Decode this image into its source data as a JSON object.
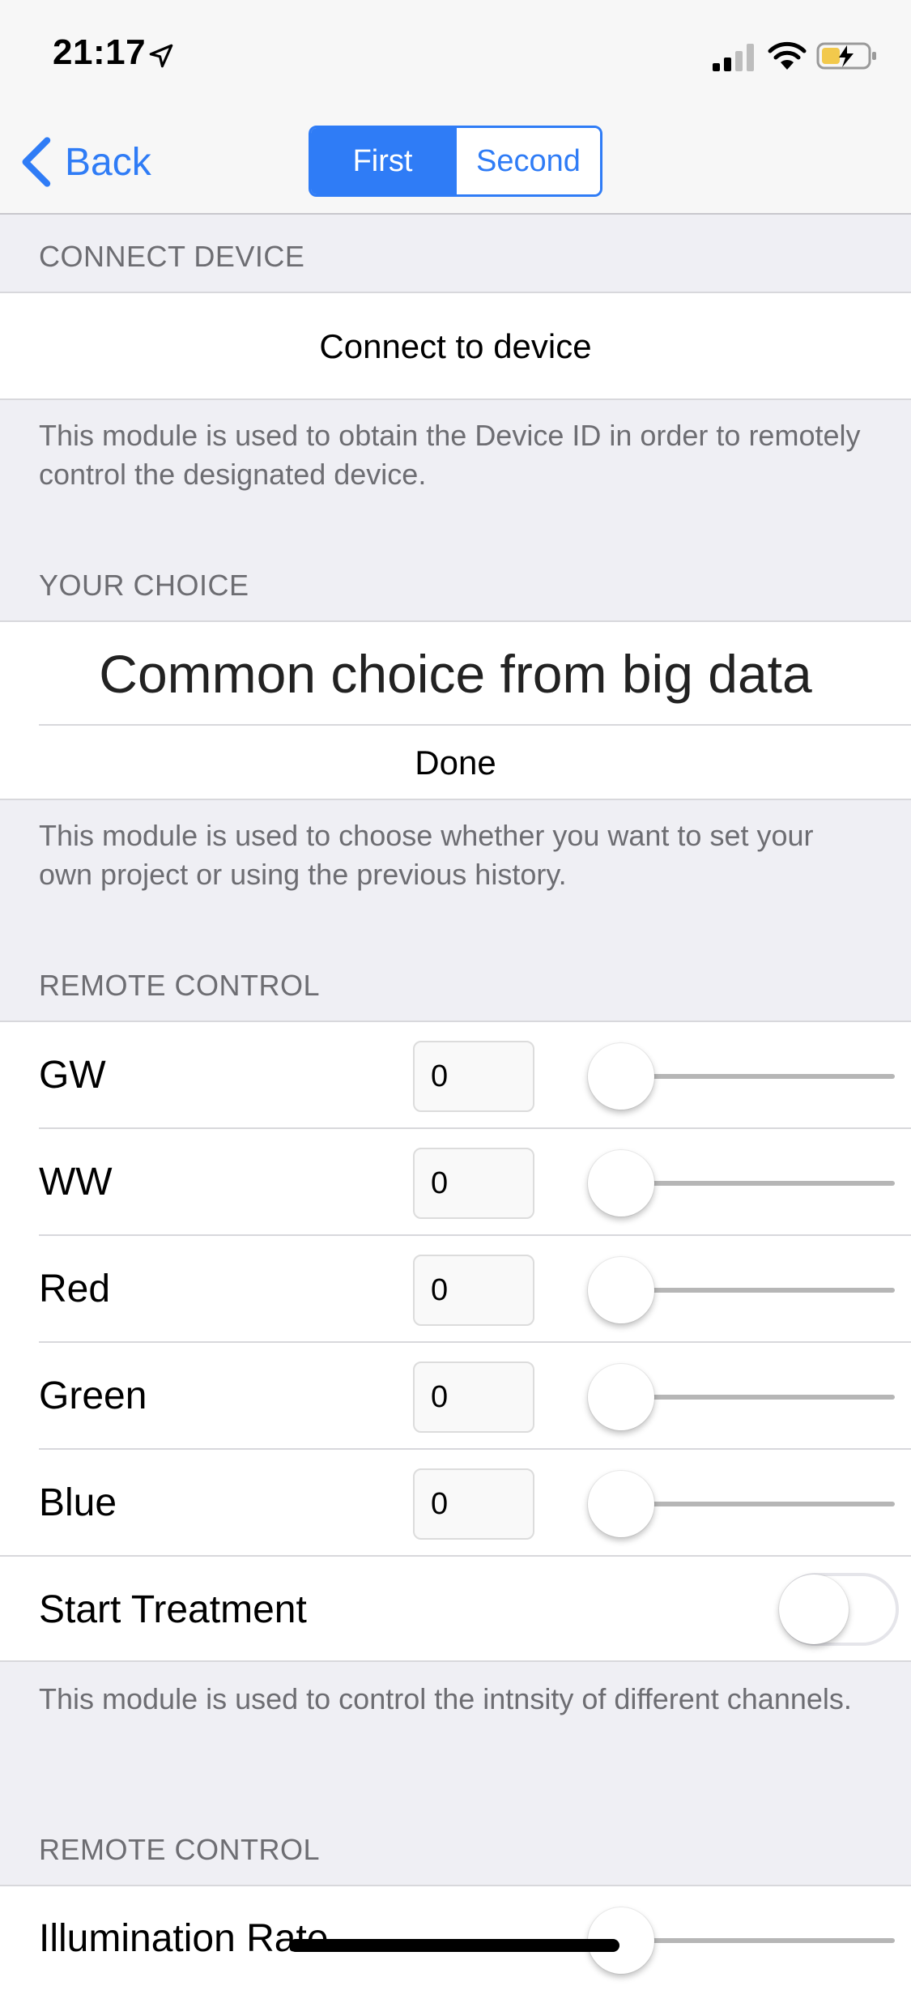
{
  "status_bar": {
    "time": "21:17",
    "icons": [
      "location-arrow-icon",
      "cellular-signal-icon",
      "wifi-icon",
      "battery-charging-icon"
    ]
  },
  "nav": {
    "back_label": "Back",
    "segments": [
      "First",
      "Second"
    ],
    "selected_segment": "First"
  },
  "sections": {
    "connect": {
      "header": "CONNECT DEVICE",
      "button": "Connect to device",
      "footer": "This module is used to obtain the Device ID in order to remotely control the designated device."
    },
    "choice": {
      "header": "YOUR CHOICE",
      "picker_value": "Common choice from big data",
      "done": "Done",
      "footer": "This module is used to choose whether you want to set your own project or using the previous history."
    },
    "remote": {
      "header": "REMOTE CONTROL",
      "channels": [
        {
          "label": "GW",
          "value": "0",
          "slider": 0
        },
        {
          "label": "WW",
          "value": "0",
          "slider": 0
        },
        {
          "label": "Red",
          "value": "0",
          "slider": 0
        },
        {
          "label": "Green",
          "value": "0",
          "slider": 0
        },
        {
          "label": "Blue",
          "value": "0",
          "slider": 0
        }
      ],
      "toggle_label": "Start Treatment",
      "toggle_on": false,
      "footer": "This module is used to control the intnsity of different channels."
    },
    "remote2": {
      "header": "REMOTE CONTROL",
      "illumination_label": "Illumination Rate",
      "illumination_slider": 0
    }
  },
  "colors": {
    "accent": "#2f7cf6",
    "background": "#efeff4",
    "secondary_text": "#6d6d72"
  }
}
